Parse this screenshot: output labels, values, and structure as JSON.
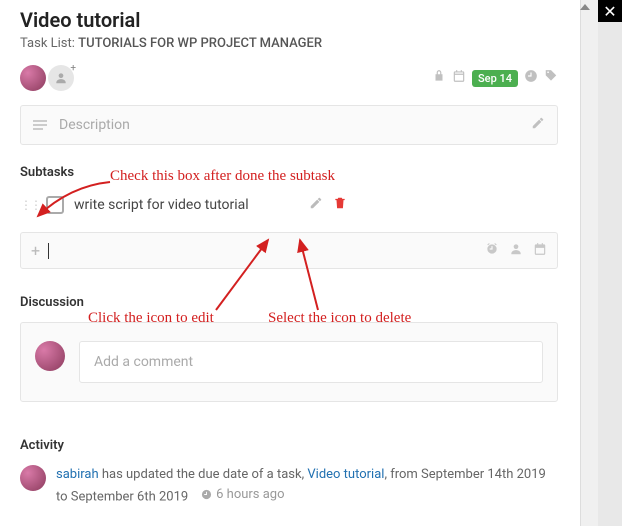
{
  "title": "Video tutorial",
  "tasklist": {
    "label": "Task List:",
    "name": "TUTORIALS FOR WP PROJECT MANAGER"
  },
  "due_date_badge": "Sep 14",
  "description_placeholder": "Description",
  "sections": {
    "subtasks": "Subtasks",
    "discussion": "Discussion",
    "activity": "Activity"
  },
  "subtasks": [
    {
      "text": "write script for video tutorial"
    }
  ],
  "comment_placeholder": "Add a comment",
  "activity": {
    "user": "sabirah",
    "text1": " has updated the due date of a task, ",
    "task_link": "Video tutorial",
    "text2": ", from September 14th 2019 to September 6th 2019",
    "time_ago": "6 hours ago"
  },
  "annotations": {
    "check": "Check this box after done the subtask",
    "edit": "Click the icon to edit",
    "delete": "Select the icon to delete"
  }
}
